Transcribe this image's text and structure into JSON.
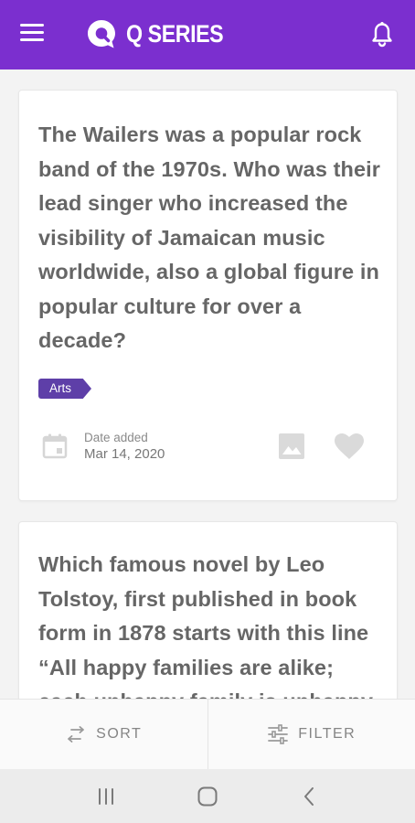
{
  "app": {
    "title": "Q SERIES",
    "brand_color": "#7b2fcf"
  },
  "header": {
    "menu_icon": "hamburger-menu-icon",
    "logo_icon": "q-logo-icon",
    "notification_icon": "bell-icon"
  },
  "questions": [
    {
      "text": "The Wailers was a popular rock band of the 1970s. Who was their lead singer who increased the visibility of Jamaican music worldwide, also a global figure in popular culture for over a decade?",
      "category": "Arts",
      "date_label": "Date added",
      "date_value": "Mar 14, 2020"
    },
    {
      "text": "Which famous novel by Leo Tolstoy, first published in book form in 1878 starts with this line “All happy families are alike; each unhappy family is unhappy in its own way”?"
    }
  ],
  "toolbar": {
    "sort_label": "SORT",
    "filter_label": "FILTER"
  },
  "tag_color": "#5e3fa8"
}
